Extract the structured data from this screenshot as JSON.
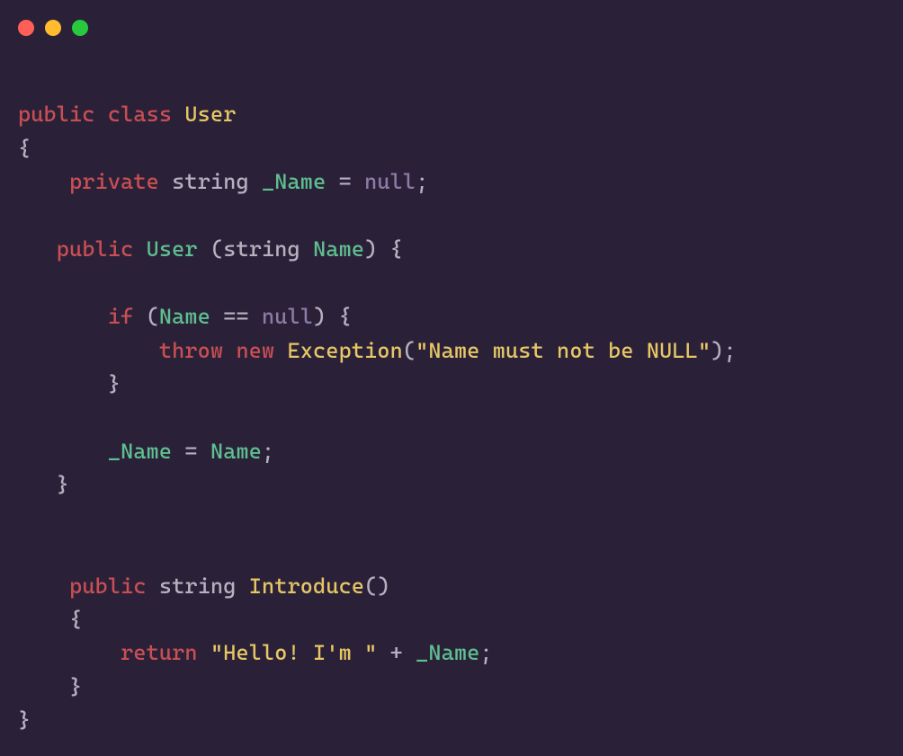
{
  "colors": {
    "background": "#2a2139",
    "keyword": "#c94f53",
    "type": "#e7c664",
    "builtin": "#b7b1bf",
    "identifier": "#5fbf8f",
    "null": "#8d7ca6",
    "string": "#e7c664",
    "punct": "#b7b1bf"
  },
  "traffic_lights": {
    "red": "#ff5f56",
    "yellow": "#ffbd2e",
    "green": "#27c93f"
  },
  "code": {
    "l1": {
      "public": "public",
      "class": "class",
      "User": "User"
    },
    "l2": {
      "brace": "{"
    },
    "l3": {
      "private": "private",
      "string": "string",
      "_Name": "_Name",
      "eq": "=",
      "null": "null",
      "semi": ";"
    },
    "l4": "",
    "l5": {
      "public": "public",
      "User": "User",
      "lp": "(",
      "string": "string",
      "Name": "Name",
      "rp": ")",
      "brace": "{"
    },
    "l6": "",
    "l7": {
      "if": "if",
      "lp": "(",
      "Name": "Name",
      "eqeq": "==",
      "null": "null",
      "rp": ")",
      "brace": "{"
    },
    "l8": {
      "throw": "throw",
      "new": "new",
      "Exception": "Exception",
      "lp": "(",
      "str": "\"Name must not be NULL\"",
      "rp": ")",
      "semi": ";"
    },
    "l9": {
      "brace": "}"
    },
    "l10": "",
    "l11": {
      "_Name": "_Name",
      "eq": "=",
      "Name": "Name",
      "semi": ";"
    },
    "l12": {
      "brace": "}"
    },
    "l13": "",
    "l14": "",
    "l15": {
      "public": "public",
      "string": "string",
      "Introduce": "Introduce",
      "lp": "(",
      "rp": ")"
    },
    "l16": {
      "brace": "{"
    },
    "l17": {
      "return": "return",
      "str": "\"Hello! I'm \"",
      "plus": "+",
      "_Name": "_Name",
      "semi": ";"
    },
    "l18": {
      "brace": "}"
    },
    "l19": {
      "brace": "}"
    }
  }
}
